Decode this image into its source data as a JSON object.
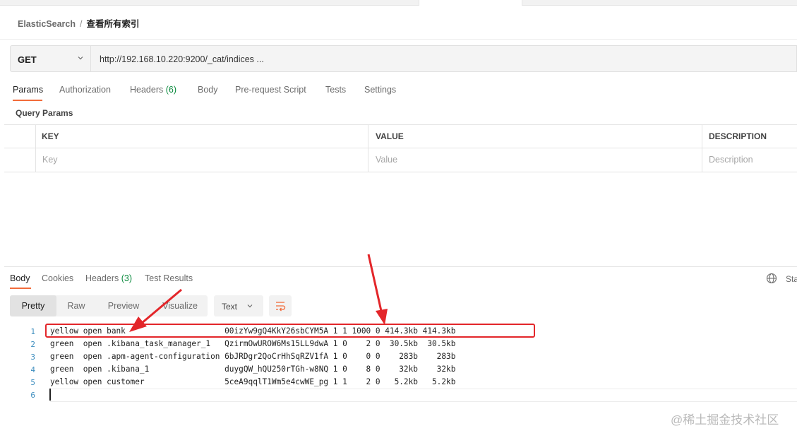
{
  "breadcrumb": {
    "parent": "ElasticSearch",
    "separator": "/",
    "current": "查看所有索引"
  },
  "request": {
    "method": "GET",
    "url": "http://192.168.10.220:9200/_cat/indices ..."
  },
  "request_tabs": [
    {
      "label": "Params",
      "count": ""
    },
    {
      "label": "Authorization",
      "count": ""
    },
    {
      "label": "Headers",
      "count": "(6)"
    },
    {
      "label": "Body",
      "count": ""
    },
    {
      "label": "Pre-request Script",
      "count": ""
    },
    {
      "label": "Tests",
      "count": ""
    },
    {
      "label": "Settings",
      "count": ""
    }
  ],
  "query_params": {
    "title": "Query Params",
    "columns": [
      "KEY",
      "VALUE",
      "DESCRIPTION"
    ],
    "placeholders": [
      "Key",
      "Value",
      "Description"
    ]
  },
  "response_tabs": [
    {
      "label": "Body",
      "count": ""
    },
    {
      "label": "Cookies",
      "count": ""
    },
    {
      "label": "Headers",
      "count": "(3)"
    },
    {
      "label": "Test Results",
      "count": ""
    }
  ],
  "response_status_partial": "Sta",
  "view_modes": [
    "Pretty",
    "Raw",
    "Preview",
    "Visualize"
  ],
  "active_view_mode": "Pretty",
  "format": "Text",
  "code_lines": [
    {
      "num": "1",
      "text": "yellow open bank                     00izYw9gQ4KkY26sbCYM5A 1 1 1000 0 414.3kb 414.3kb"
    },
    {
      "num": "2",
      "text": "green  open .kibana_task_manager_1   QzirmOwUROW6Ms15LL9dwA 1 0    2 0  30.5kb  30.5kb"
    },
    {
      "num": "3",
      "text": "green  open .apm-agent-configuration 6bJRDgr2QoCrHhSqRZV1fA 1 0    0 0    283b    283b"
    },
    {
      "num": "4",
      "text": "green  open .kibana_1                duygQW_hQU250rTGh-w8NQ 1 0    8 0    32kb    32kb"
    },
    {
      "num": "5",
      "text": "yellow open customer                 5ceA9qqlT1Wm5e4cwWE_pg 1 1    2 0   5.2kb   5.2kb"
    },
    {
      "num": "6",
      "text": ""
    }
  ],
  "watermark": "@稀土掘金技术社区",
  "colors": {
    "accent": "#f26b3a",
    "count_green": "#0b8a3e",
    "annotation_red": "#e3262a",
    "line_number": "#3e8ebf"
  }
}
